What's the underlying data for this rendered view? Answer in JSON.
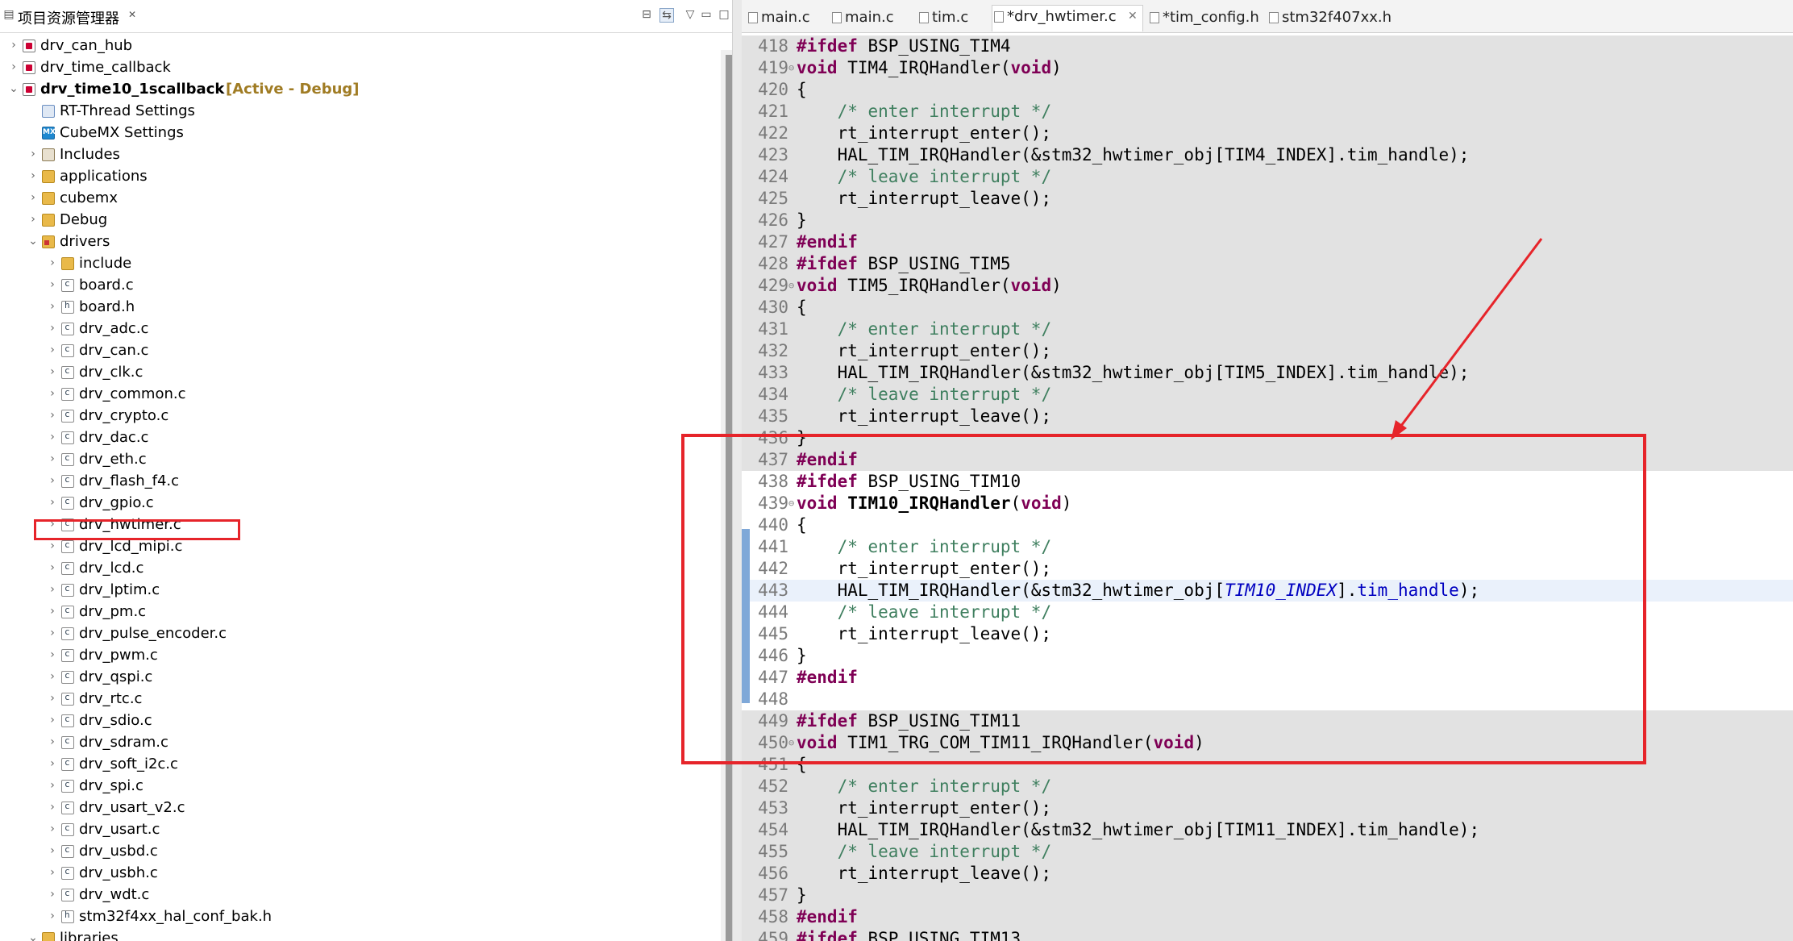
{
  "explorer": {
    "title": "项目资源管理器",
    "close_glyph": "✕",
    "tree": [
      {
        "label": "drv_can_hub",
        "icon": "project-icon",
        "depth": 0,
        "expanded": false
      },
      {
        "label": "drv_time_callback",
        "icon": "project-icon",
        "depth": 0,
        "expanded": false
      },
      {
        "label": "drv_time10_1scallback",
        "icon": "project-icon",
        "depth": 0,
        "expanded": true,
        "extra": "[Active - Debug]",
        "bold": true
      },
      {
        "label": "RT-Thread Settings",
        "icon": "rt-thread-icon",
        "depth": 1,
        "expanded": null
      },
      {
        "label": "CubeMX Settings",
        "icon": "cubemx-icon",
        "depth": 1,
        "expanded": null
      },
      {
        "label": "Includes",
        "icon": "includes-icon",
        "depth": 1,
        "expanded": false
      },
      {
        "label": "applications",
        "icon": "folder-icon",
        "depth": 1,
        "expanded": false
      },
      {
        "label": "cubemx",
        "icon": "folder-icon",
        "depth": 1,
        "expanded": false
      },
      {
        "label": "Debug",
        "icon": "folder-icon",
        "depth": 1,
        "expanded": false
      },
      {
        "label": "drivers",
        "icon": "source-folder-icon",
        "depth": 1,
        "expanded": true
      },
      {
        "label": "include",
        "icon": "folder-icon",
        "depth": 2,
        "expanded": false
      },
      {
        "label": "board.c",
        "icon": "c-file-icon",
        "depth": 2,
        "expanded": false
      },
      {
        "label": "board.h",
        "icon": "h-file-icon",
        "depth": 2,
        "expanded": false
      },
      {
        "label": "drv_adc.c",
        "icon": "c-file-icon",
        "depth": 2,
        "expanded": false
      },
      {
        "label": "drv_can.c",
        "icon": "c-file-icon",
        "depth": 2,
        "expanded": false
      },
      {
        "label": "drv_clk.c",
        "icon": "c-file-icon",
        "depth": 2,
        "expanded": false
      },
      {
        "label": "drv_common.c",
        "icon": "c-file-icon",
        "depth": 2,
        "expanded": false
      },
      {
        "label": "drv_crypto.c",
        "icon": "c-file-icon",
        "depth": 2,
        "expanded": false
      },
      {
        "label": "drv_dac.c",
        "icon": "c-file-icon",
        "depth": 2,
        "expanded": false
      },
      {
        "label": "drv_eth.c",
        "icon": "c-file-icon",
        "depth": 2,
        "expanded": false
      },
      {
        "label": "drv_flash_f4.c",
        "icon": "c-file-icon",
        "depth": 2,
        "expanded": false
      },
      {
        "label": "drv_gpio.c",
        "icon": "c-file-icon",
        "depth": 2,
        "expanded": false
      },
      {
        "label": "drv_hwtimer.c",
        "icon": "c-file-icon",
        "depth": 2,
        "expanded": false
      },
      {
        "label": "drv_lcd_mipi.c",
        "icon": "c-file-icon",
        "depth": 2,
        "expanded": false
      },
      {
        "label": "drv_lcd.c",
        "icon": "c-file-icon",
        "depth": 2,
        "expanded": false
      },
      {
        "label": "drv_lptim.c",
        "icon": "c-file-icon",
        "depth": 2,
        "expanded": false
      },
      {
        "label": "drv_pm.c",
        "icon": "c-file-icon",
        "depth": 2,
        "expanded": false
      },
      {
        "label": "drv_pulse_encoder.c",
        "icon": "c-file-icon",
        "depth": 2,
        "expanded": false
      },
      {
        "label": "drv_pwm.c",
        "icon": "c-file-icon",
        "depth": 2,
        "expanded": false
      },
      {
        "label": "drv_qspi.c",
        "icon": "c-file-icon",
        "depth": 2,
        "expanded": false
      },
      {
        "label": "drv_rtc.c",
        "icon": "c-file-icon",
        "depth": 2,
        "expanded": false
      },
      {
        "label": "drv_sdio.c",
        "icon": "c-file-icon",
        "depth": 2,
        "expanded": false
      },
      {
        "label": "drv_sdram.c",
        "icon": "c-file-icon",
        "depth": 2,
        "expanded": false
      },
      {
        "label": "drv_soft_i2c.c",
        "icon": "c-file-icon",
        "depth": 2,
        "expanded": false
      },
      {
        "label": "drv_spi.c",
        "icon": "c-file-icon",
        "depth": 2,
        "expanded": false
      },
      {
        "label": "drv_usart_v2.c",
        "icon": "c-file-icon",
        "depth": 2,
        "expanded": false
      },
      {
        "label": "drv_usart.c",
        "icon": "c-file-icon",
        "depth": 2,
        "expanded": false
      },
      {
        "label": "drv_usbd.c",
        "icon": "c-file-icon",
        "depth": 2,
        "expanded": false
      },
      {
        "label": "drv_usbh.c",
        "icon": "c-file-icon",
        "depth": 2,
        "expanded": false
      },
      {
        "label": "drv_wdt.c",
        "icon": "c-file-icon",
        "depth": 2,
        "expanded": false
      },
      {
        "label": "stm32f4xx_hal_conf_bak.h",
        "icon": "h-file-icon",
        "depth": 2,
        "expanded": false
      },
      {
        "label": "libraries",
        "icon": "folder-icon",
        "depth": 1,
        "expanded": true
      }
    ]
  },
  "editor": {
    "tabs": [
      {
        "label": "main.c",
        "active": false
      },
      {
        "label": "main.c",
        "active": false
      },
      {
        "label": "tim.c",
        "active": false
      },
      {
        "label": "*drv_hwtimer.c",
        "active": true
      },
      {
        "label": "*tim_config.h",
        "active": false
      },
      {
        "label": "stm32f407xx.h",
        "active": false
      }
    ],
    "lines": [
      {
        "n": "418",
        "bg": "grey",
        "tokens": [
          [
            "pp",
            "#ifdef"
          ],
          [
            "t",
            " BSP_USING_TIM4"
          ]
        ]
      },
      {
        "n": "419",
        "bg": "grey",
        "fold": true,
        "tokens": [
          [
            "kw",
            "void"
          ],
          [
            "t",
            " TIM4_IRQHandler("
          ],
          [
            "kw",
            "void"
          ],
          [
            "t",
            ")"
          ]
        ]
      },
      {
        "n": "420",
        "bg": "grey",
        "tokens": [
          [
            "t",
            "{"
          ]
        ]
      },
      {
        "n": "421",
        "bg": "grey",
        "tokens": [
          [
            "t",
            "    "
          ],
          [
            "cm",
            "/* enter interrupt */"
          ]
        ]
      },
      {
        "n": "422",
        "bg": "grey",
        "tokens": [
          [
            "t",
            "    rt_interrupt_enter();"
          ]
        ]
      },
      {
        "n": "423",
        "bg": "grey",
        "tokens": [
          [
            "t",
            "    HAL_TIM_IRQHandler(&stm32_hwtimer_obj[TIM4_INDEX].tim_handle);"
          ]
        ]
      },
      {
        "n": "424",
        "bg": "grey",
        "tokens": [
          [
            "t",
            "    "
          ],
          [
            "cm",
            "/* leave interrupt */"
          ]
        ]
      },
      {
        "n": "425",
        "bg": "grey",
        "tokens": [
          [
            "t",
            "    rt_interrupt_leave();"
          ]
        ]
      },
      {
        "n": "426",
        "bg": "grey",
        "tokens": [
          [
            "t",
            "}"
          ]
        ]
      },
      {
        "n": "427",
        "bg": "grey",
        "tokens": [
          [
            "pp",
            "#endif"
          ]
        ]
      },
      {
        "n": "428",
        "bg": "grey",
        "tokens": [
          [
            "pp",
            "#ifdef"
          ],
          [
            "t",
            " BSP_USING_TIM5"
          ]
        ]
      },
      {
        "n": "429",
        "bg": "grey",
        "fold": true,
        "tokens": [
          [
            "kw",
            "void"
          ],
          [
            "t",
            " TIM5_IRQHandler("
          ],
          [
            "kw",
            "void"
          ],
          [
            "t",
            ")"
          ]
        ]
      },
      {
        "n": "430",
        "bg": "grey",
        "tokens": [
          [
            "t",
            "{"
          ]
        ]
      },
      {
        "n": "431",
        "bg": "grey",
        "tokens": [
          [
            "t",
            "    "
          ],
          [
            "cm",
            "/* enter interrupt */"
          ]
        ]
      },
      {
        "n": "432",
        "bg": "grey",
        "tokens": [
          [
            "t",
            "    rt_interrupt_enter();"
          ]
        ]
      },
      {
        "n": "433",
        "bg": "grey",
        "tokens": [
          [
            "t",
            "    HAL_TIM_IRQHandler(&stm32_hwtimer_obj[TIM5_INDEX].tim_handle);"
          ]
        ]
      },
      {
        "n": "434",
        "bg": "grey",
        "tokens": [
          [
            "t",
            "    "
          ],
          [
            "cm",
            "/* leave interrupt */"
          ]
        ]
      },
      {
        "n": "435",
        "bg": "grey",
        "tokens": [
          [
            "t",
            "    rt_interrupt_leave();"
          ]
        ]
      },
      {
        "n": "436",
        "bg": "grey",
        "tokens": [
          [
            "t",
            "}"
          ]
        ]
      },
      {
        "n": "437",
        "bg": "grey",
        "tokens": [
          [
            "pp",
            "#endif"
          ]
        ]
      },
      {
        "n": "438",
        "bg": "white",
        "tokens": [
          [
            "pp",
            "#ifdef"
          ],
          [
            "t",
            " BSP_USING_TIM10"
          ]
        ]
      },
      {
        "n": "439",
        "bg": "white",
        "fold": true,
        "tokens": [
          [
            "kw",
            "void"
          ],
          [
            "t",
            " "
          ],
          [
            "fn",
            "TIM10_IRQHandler"
          ],
          [
            "t",
            "("
          ],
          [
            "kw",
            "void"
          ],
          [
            "t",
            ")"
          ]
        ]
      },
      {
        "n": "440",
        "bg": "white",
        "tokens": [
          [
            "t",
            "{"
          ]
        ]
      },
      {
        "n": "441",
        "bg": "white",
        "tokens": [
          [
            "t",
            "    "
          ],
          [
            "cm",
            "/* enter interrupt */"
          ]
        ]
      },
      {
        "n": "442",
        "bg": "white",
        "tokens": [
          [
            "t",
            "    rt_interrupt_enter();"
          ]
        ]
      },
      {
        "n": "443",
        "bg": "cur",
        "tokens": [
          [
            "t",
            "    HAL_TIM_IRQHandler(&stm32_hwtimer_obj["
          ],
          [
            "it",
            "TIM10_INDEX"
          ],
          [
            "t",
            "]."
          ],
          [
            "var",
            "tim_handle"
          ],
          [
            "t",
            ");"
          ]
        ]
      },
      {
        "n": "444",
        "bg": "white",
        "tokens": [
          [
            "t",
            "    "
          ],
          [
            "cm",
            "/* leave interrupt */"
          ]
        ]
      },
      {
        "n": "445",
        "bg": "white",
        "tokens": [
          [
            "t",
            "    rt_interrupt_leave();"
          ]
        ]
      },
      {
        "n": "446",
        "bg": "white",
        "tokens": [
          [
            "t",
            "}"
          ]
        ]
      },
      {
        "n": "447",
        "bg": "white",
        "tokens": [
          [
            "pp",
            "#endif"
          ]
        ]
      },
      {
        "n": "448",
        "bg": "white",
        "tokens": []
      },
      {
        "n": "449",
        "bg": "grey",
        "tokens": [
          [
            "pp",
            "#ifdef"
          ],
          [
            "t",
            " BSP_USING_TIM11"
          ]
        ]
      },
      {
        "n": "450",
        "bg": "grey",
        "fold": true,
        "tokens": [
          [
            "kw",
            "void"
          ],
          [
            "t",
            " TIM1_TRG_COM_TIM11_IRQHandler("
          ],
          [
            "kw",
            "void"
          ],
          [
            "t",
            ")"
          ]
        ]
      },
      {
        "n": "451",
        "bg": "grey",
        "tokens": [
          [
            "t",
            "{"
          ]
        ]
      },
      {
        "n": "452",
        "bg": "grey",
        "tokens": [
          [
            "t",
            "    "
          ],
          [
            "cm",
            "/* enter interrupt */"
          ]
        ]
      },
      {
        "n": "453",
        "bg": "grey",
        "tokens": [
          [
            "t",
            "    rt_interrupt_enter();"
          ]
        ]
      },
      {
        "n": "454",
        "bg": "grey",
        "tokens": [
          [
            "t",
            "    HAL_TIM_IRQHandler(&stm32_hwtimer_obj[TIM11_INDEX].tim_handle);"
          ]
        ]
      },
      {
        "n": "455",
        "bg": "grey",
        "tokens": [
          [
            "t",
            "    "
          ],
          [
            "cm",
            "/* leave interrupt */"
          ]
        ]
      },
      {
        "n": "456",
        "bg": "grey",
        "tokens": [
          [
            "t",
            "    rt_interrupt_leave();"
          ]
        ]
      },
      {
        "n": "457",
        "bg": "grey",
        "tokens": [
          [
            "t",
            "}"
          ]
        ]
      },
      {
        "n": "458",
        "bg": "grey",
        "tokens": [
          [
            "pp",
            "#endif"
          ]
        ]
      },
      {
        "n": "459",
        "bg": "grey",
        "tokens": [
          [
            "pp",
            "#ifdef"
          ],
          [
            "t",
            " BSP_USING_TIM13"
          ]
        ]
      }
    ]
  },
  "colors": {
    "annotation": "#e6242a",
    "keyword": "#7f0055",
    "comment": "#3f7f5f",
    "field": "#0000c0",
    "active_badge": "#a07c24"
  }
}
